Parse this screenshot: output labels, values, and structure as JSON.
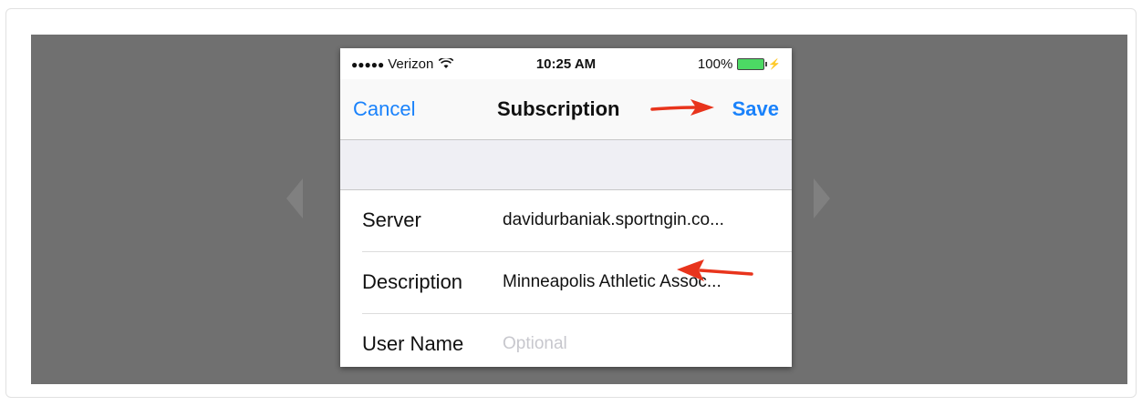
{
  "status_bar": {
    "signal": "●●●●●",
    "carrier": "Verizon",
    "wifi_icon": "wifi-icon",
    "time": "10:25 AM",
    "battery_percent": "100%",
    "battery_icon": "battery-icon",
    "charging_icon": "bolt-icon"
  },
  "nav": {
    "cancel_label": "Cancel",
    "title": "Subscription",
    "save_label": "Save",
    "accent_color": "#1a82fb"
  },
  "form": {
    "rows": [
      {
        "label": "Server",
        "value": "davidurbaniak.sportngin.co...",
        "placeholder": ""
      },
      {
        "label": "Description",
        "value": "Minneapolis Athletic Assoc...",
        "placeholder": ""
      },
      {
        "label": "User Name",
        "value": "",
        "placeholder": "Optional"
      }
    ]
  },
  "annotations": {
    "arrow_color": "#e8341c",
    "arrows": [
      "arrow-to-save",
      "arrow-to-description"
    ]
  }
}
